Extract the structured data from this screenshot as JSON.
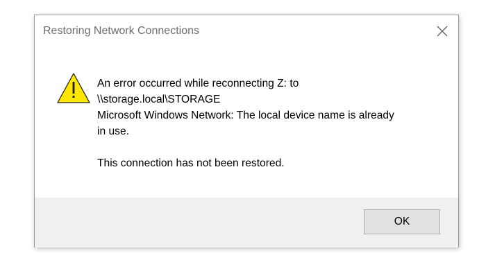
{
  "window": {
    "title": "Restoring Network Connections"
  },
  "icons": {
    "warning": "warning-icon",
    "close": "close-icon"
  },
  "message": {
    "line1": "An error occurred while reconnecting Z: to",
    "line2": "\\\\storage.local\\STORAGE",
    "line3": "Microsoft Windows Network: The local device name is already",
    "line4": "in use.",
    "line5": "This connection has not been restored."
  },
  "buttons": {
    "ok_label": "OK"
  },
  "colors": {
    "warning_fill": "#ffe600",
    "warning_stroke": "#1a1a1a",
    "footer_bg": "#f0f0f0",
    "button_bg": "#e1e1e1",
    "button_border": "#adadad",
    "title_text": "#6d6d6d"
  }
}
